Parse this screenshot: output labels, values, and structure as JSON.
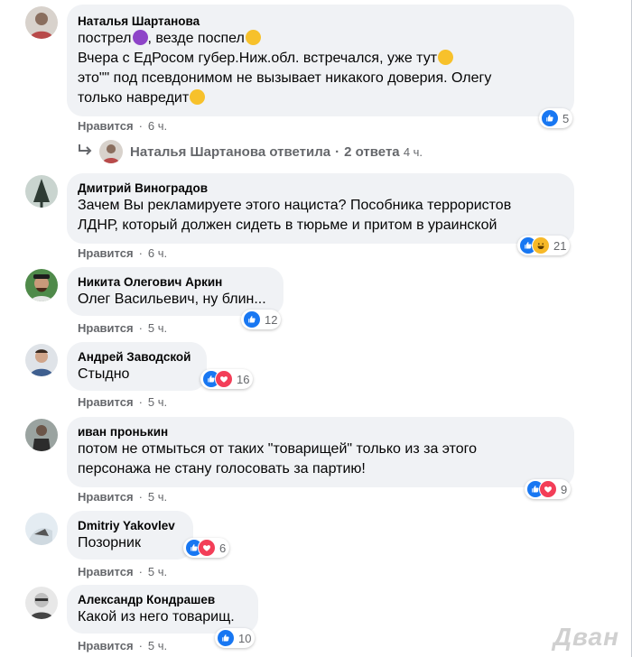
{
  "comments": [
    {
      "author": "Наталья Шартанова",
      "lines": [
        "пострел",
        ", везде поспел",
        "Вчера с ЕдРосом губер.Ниж.обл. встречался, уже тут",
        "это\"\" под псевдонимом не вызывает никакого доверия. Олегу",
        "только навредит"
      ],
      "like_label": "Нравится",
      "time": "6 ч.",
      "reaction_count": "5"
    },
    {
      "author": "Дмитрий Виноградов",
      "lines": [
        "Зачем Вы рекламируете этого нациста? Пособника террористов",
        "ЛДНР, который должен сидеть в тюрьме и притом в ураинской"
      ],
      "like_label": "Нравится",
      "time": "6 ч.",
      "reaction_count": "21"
    },
    {
      "author": "Никита Олегович Аркин",
      "lines": [
        "Олег Васильевич, ну блин..."
      ],
      "like_label": "Нравится",
      "time": "5 ч.",
      "reaction_count": "12"
    },
    {
      "author": "Андрей Заводской",
      "lines": [
        "Стыдно"
      ],
      "like_label": "Нравится",
      "time": "5 ч.",
      "reaction_count": "16"
    },
    {
      "author": "иван пронькин",
      "lines": [
        "потом не отмыться от таких \"товарищей\" только из за этого",
        "персонажа не стану голосовать за партию!"
      ],
      "like_label": "Нравится",
      "time": "5 ч.",
      "reaction_count": "9"
    },
    {
      "author": "Dmitriy Yakovlev",
      "lines": [
        "Позорник"
      ],
      "like_label": "Нравится",
      "time": "5 ч.",
      "reaction_count": "6"
    },
    {
      "author": "Александр Кондрашев",
      "lines": [
        "Какой из него товарищ."
      ],
      "like_label": "Нравится",
      "time": "5 ч.",
      "reaction_count": "10"
    }
  ],
  "reply_summary": {
    "author": "Наталья Шартанова",
    "verb": "ответила",
    "replies": "2 ответа",
    "time": "4 ч."
  },
  "watermark": "Дван",
  "colors": {
    "like": "#1877f2",
    "heart": "#f33e58",
    "haha": "#f7b928",
    "bubble": "#f0f2f5",
    "muted": "#65676b"
  },
  "icons": {
    "reply_arrow": "reply-arrow-icon",
    "like": "like-reaction-icon",
    "love": "love-reaction-icon",
    "haha": "haha-reaction-icon"
  }
}
